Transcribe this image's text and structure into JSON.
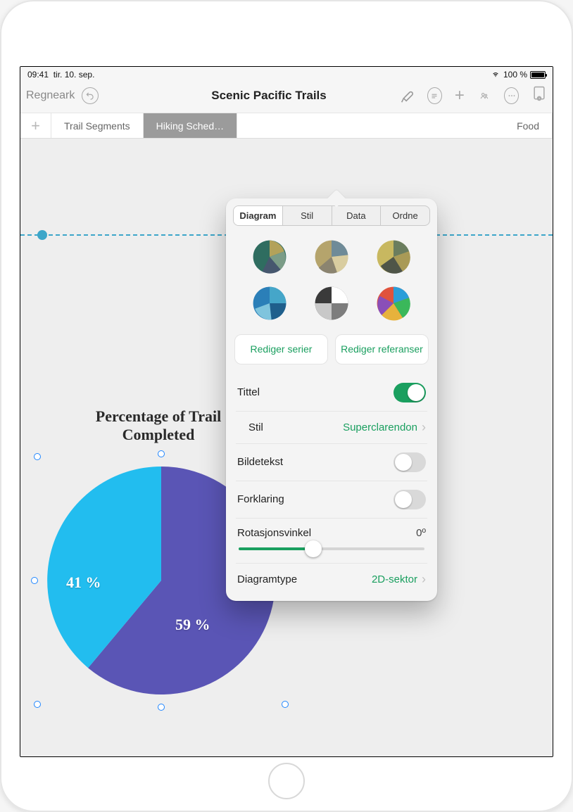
{
  "statusbar": {
    "time": "09:41",
    "date": "tir. 10. sep.",
    "battery_pct": "100 %"
  },
  "toolbar": {
    "back_label": "Regneark",
    "title": "Scenic Pacific Trails"
  },
  "tabs": {
    "items": [
      {
        "label": "Trail Segments"
      },
      {
        "label": "Hiking Sched…"
      },
      {
        "label": "Food"
      }
    ]
  },
  "chart_data": {
    "type": "pie",
    "title": "Percentage of Trail Completed",
    "slices": [
      {
        "label": "41 %",
        "value": 41,
        "color": "#22bdef"
      },
      {
        "label": "59 %",
        "value": 59,
        "color": "#5a55b5"
      }
    ]
  },
  "popover": {
    "segments": [
      "Diagram",
      "Stil",
      "Data",
      "Ordne"
    ],
    "active_segment": 0,
    "edit_series_label": "Rediger serier",
    "edit_refs_label": "Rediger referanser",
    "title_label": "Tittel",
    "title_on": true,
    "style_label": "Stil",
    "style_value": "Superclarendon",
    "caption_label": "Bildetekst",
    "caption_on": false,
    "legend_label": "Forklaring",
    "legend_on": false,
    "rotation_label": "Rotasjonsvinkel",
    "rotation_value": "0º",
    "type_label": "Diagramtype",
    "type_value": "2D-sektor"
  }
}
